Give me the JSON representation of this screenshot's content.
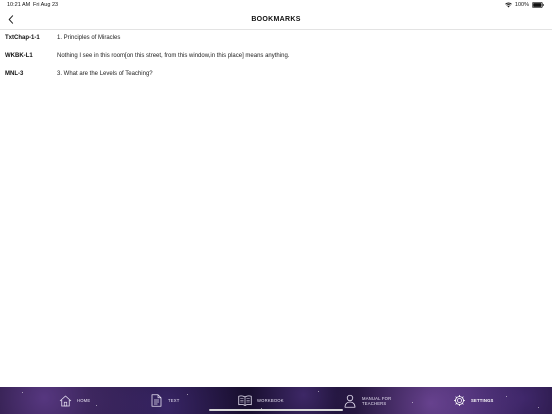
{
  "status_bar": {
    "time": "10:21 AM",
    "date": "Fri Aug 23",
    "battery": "100%"
  },
  "nav": {
    "title": "BOOKMARKS",
    "back_icon": "chevron-left-icon"
  },
  "bookmarks": [
    {
      "code": "TxtChap-1-1",
      "title": "1. Principles of Miracles"
    },
    {
      "code": "WKBK-L1",
      "title": "Nothing I see in this room[on this street, from this window,in this place] means anything."
    },
    {
      "code": "MNL-3",
      "title": "3. What are the Levels of Teaching?"
    }
  ],
  "tabs": [
    {
      "label": "HOME",
      "icon": "home-icon",
      "active": false
    },
    {
      "label": "TEXT",
      "icon": "document-icon",
      "active": false
    },
    {
      "label": "WORKBOOK",
      "icon": "open-book-icon",
      "active": false
    },
    {
      "label": "MANUAL FOR TEACHERS",
      "icon": "person-icon",
      "active": false
    },
    {
      "label": "SETTINGS",
      "icon": "gear-icon",
      "active": true
    }
  ],
  "colors": {
    "tab_bar_base": "#1d1236",
    "tab_bar_glow": "#8c5ac8",
    "tab_text": "#e9e4f4"
  }
}
